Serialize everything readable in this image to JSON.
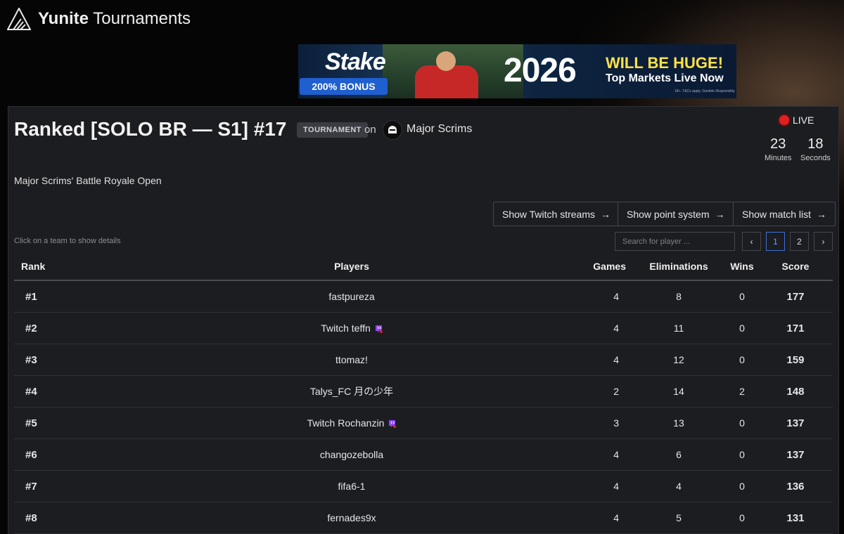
{
  "header": {
    "brand_bold": "Yunite",
    "brand_rest": "Tournaments"
  },
  "ad": {
    "stake": "Stake",
    "bonus": "200% BONUS",
    "year": "2026",
    "headline": "WILL BE HUGE!",
    "subline": "Top Markets Live Now",
    "fine_print": "18+. T&Cs apply. Gamble Responsibly."
  },
  "tournament": {
    "title": "Ranked [SOLO BR — S1] #17",
    "tag": "TOURNAMENT",
    "on": "on",
    "organizer": "Major Scrims",
    "subtitle": "Major Scrims' Battle Royale Open",
    "live_label": "LIVE",
    "timer": {
      "minutes": "23",
      "minutes_label": "Minutes",
      "seconds": "18",
      "seconds_label": "Seconds"
    }
  },
  "actions": {
    "twitch": "Show Twitch streams",
    "points": "Show point system",
    "matches": "Show match list"
  },
  "hint": "Click on a team to show details",
  "search": {
    "placeholder": "Search for player ..."
  },
  "pagination": {
    "prev": "‹",
    "pages": [
      "1",
      "2"
    ],
    "next": "›",
    "current": "1"
  },
  "table": {
    "headers": {
      "rank": "Rank",
      "players": "Players",
      "games": "Games",
      "eliminations": "Eliminations",
      "wins": "Wins",
      "score": "Score"
    },
    "rows": [
      {
        "rank": "#1",
        "player": "fastpureza",
        "twitch": false,
        "games": "4",
        "eliminations": "8",
        "wins": "0",
        "score": "177"
      },
      {
        "rank": "#2",
        "player": "Twitch teffn",
        "twitch": true,
        "games": "4",
        "eliminations": "11",
        "wins": "0",
        "score": "171"
      },
      {
        "rank": "#3",
        "player": "ttomaz!",
        "twitch": false,
        "games": "4",
        "eliminations": "12",
        "wins": "0",
        "score": "159"
      },
      {
        "rank": "#4",
        "player": "Talys_FC 月の少年",
        "twitch": false,
        "games": "2",
        "eliminations": "14",
        "wins": "2",
        "score": "148"
      },
      {
        "rank": "#5",
        "player": "Twitch Rochanzin",
        "twitch": true,
        "games": "3",
        "eliminations": "13",
        "wins": "0",
        "score": "137"
      },
      {
        "rank": "#6",
        "player": "changozebolla",
        "twitch": false,
        "games": "4",
        "eliminations": "6",
        "wins": "0",
        "score": "137"
      },
      {
        "rank": "#7",
        "player": "fifa6-1",
        "twitch": false,
        "games": "4",
        "eliminations": "4",
        "wins": "0",
        "score": "136"
      },
      {
        "rank": "#8",
        "player": "fernades9x",
        "twitch": false,
        "games": "4",
        "eliminations": "5",
        "wins": "0",
        "score": "131"
      }
    ]
  }
}
